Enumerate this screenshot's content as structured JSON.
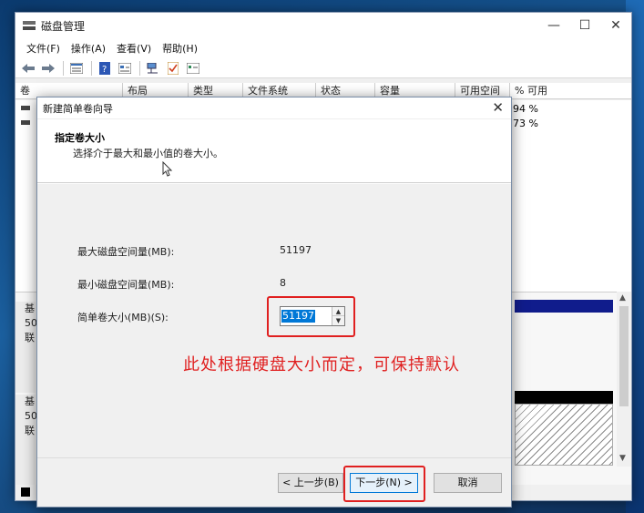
{
  "window": {
    "title": "磁盘管理",
    "minimize": "—",
    "maximize": "☐",
    "close": "✕"
  },
  "menu": [
    "文件(F)",
    "操作(A)",
    "查看(V)",
    "帮助(H)"
  ],
  "toolbar": {
    "icons": [
      "back-arrow-icon",
      "forward-arrow-icon",
      "list-view-icon",
      "help-icon",
      "properties-icon",
      "connect-icon",
      "check-icon",
      "settings-panel-icon"
    ]
  },
  "volume_list": {
    "columns": [
      "卷",
      "布局",
      "类型",
      "文件系统",
      "状态",
      "容量",
      "可用空间",
      "% 可用"
    ],
    "rows": [
      {
        "name": "",
        "pct": "94 %"
      },
      {
        "name": "",
        "pct": "73 %"
      }
    ]
  },
  "disks": [
    {
      "line1": "基",
      "line2": "50",
      "line3": "联"
    },
    {
      "line1": "基",
      "line2": "50",
      "line3": "联"
    }
  ],
  "wizard": {
    "title": "新建简单卷向导",
    "close": "✕",
    "heading": "指定卷大小",
    "subheading": "选择介于最大和最小值的卷大小。",
    "max_label": "最大磁盘空间量(MB):",
    "max_value": "51197",
    "min_label": "最小磁盘空间量(MB):",
    "min_value": "8",
    "size_label": "简单卷大小(MB)(S):",
    "size_value": "51197",
    "annotation": "此处根据硬盘大小而定，可保持默认",
    "back_label": "< 上一步(B)",
    "next_label": "下一步(N) >",
    "cancel_label": "取消"
  },
  "colors": {
    "annotation": "#e02020",
    "selection": "#0078d7",
    "disk_primary": "#101c8c"
  }
}
